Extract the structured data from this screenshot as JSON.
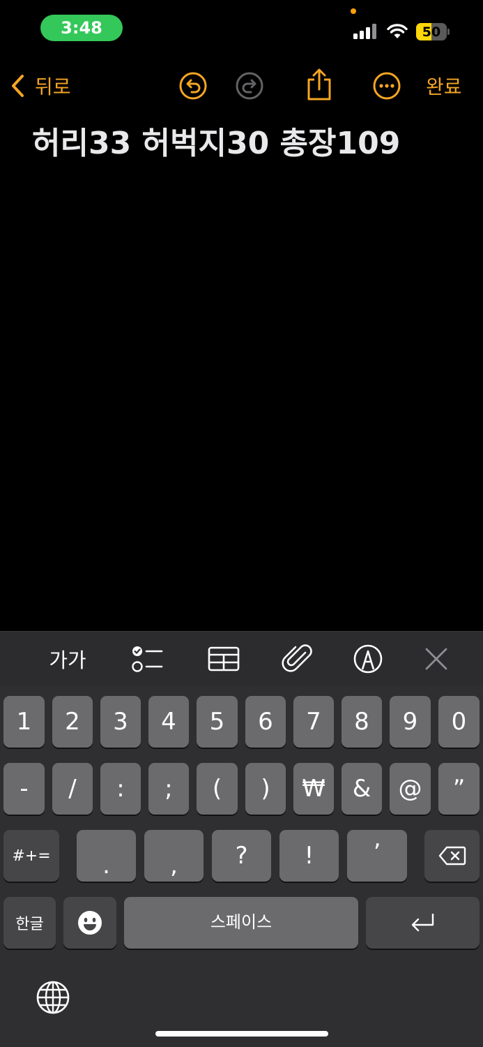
{
  "status_bar": {
    "time": "3:48",
    "battery": "50",
    "battery_level": 0.5,
    "indicator_color": "#ff9f0a",
    "time_pill_color": "#34c759"
  },
  "nav": {
    "back_label": "뒤로",
    "done_label": "완료",
    "accent": "#f5a623",
    "icons": [
      "undo-icon",
      "redo-icon",
      "share-icon",
      "more-icon"
    ]
  },
  "note": {
    "text": "허리33 허벅지30 총장109"
  },
  "keyboard_toolbar": {
    "format_label": "가가",
    "icons": [
      "checklist-icon",
      "table-icon",
      "attachment-icon",
      "markup-icon",
      "close-icon"
    ]
  },
  "keyboard": {
    "row1": [
      "1",
      "2",
      "3",
      "4",
      "5",
      "6",
      "7",
      "8",
      "9",
      "0"
    ],
    "row2": [
      "-",
      "/",
      ":",
      ";",
      "(",
      ")",
      "₩",
      "&",
      "@",
      "”"
    ],
    "row3_left": "#+=",
    "row3": [
      ".",
      ",",
      "?",
      "!",
      "’"
    ],
    "korean_label": "한글",
    "space_label": "스페이스",
    "icons": [
      "delete-icon",
      "emoji-icon",
      "return-icon",
      "globe-icon"
    ]
  }
}
